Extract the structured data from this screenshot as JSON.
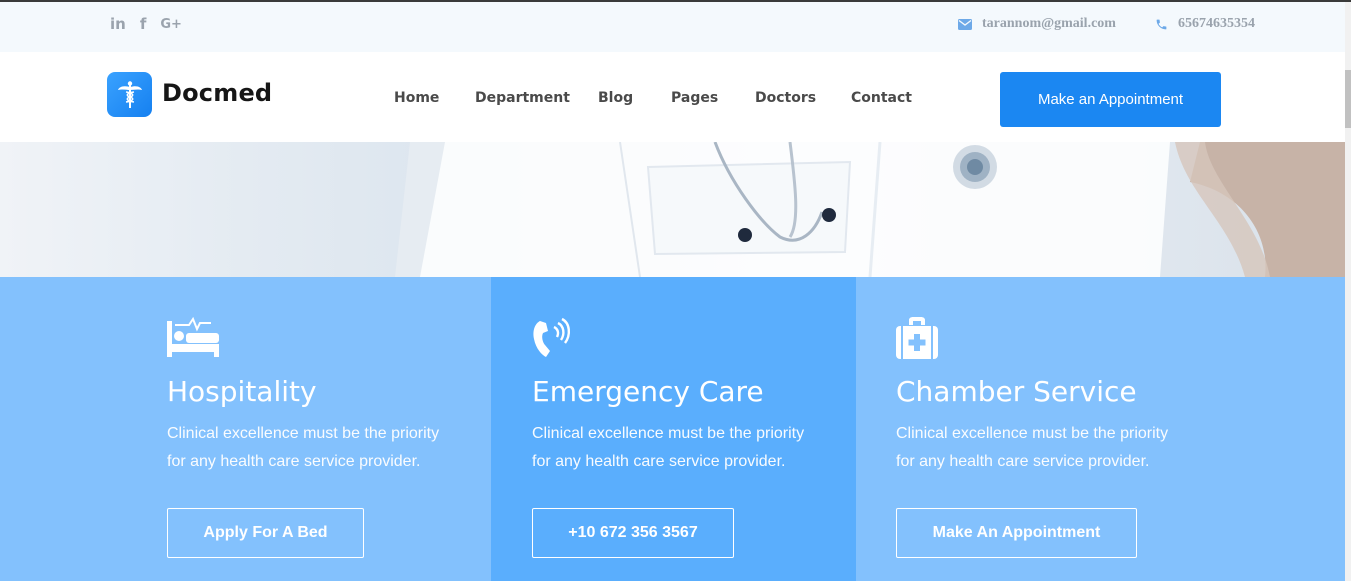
{
  "topbar": {
    "social": [
      {
        "label": "in",
        "icon": "linkedin-icon"
      },
      {
        "label": "f",
        "icon": "facebook-icon"
      },
      {
        "label": "G+",
        "icon": "google-plus-icon"
      }
    ],
    "email": "tarannom@gmail.com",
    "phone": "65674635354"
  },
  "header": {
    "logo_text": "Docmed",
    "logo_icon": "caduceus-icon",
    "nav": [
      "Home",
      "Department",
      "Blog",
      "Pages",
      "Doctors",
      "Contact"
    ],
    "cta_label": "Make an Appointment"
  },
  "colors": {
    "accent": "#1b87f2",
    "card_light": "#83c1fd",
    "card_dark": "#5aaefd"
  },
  "services": [
    {
      "icon": "hospital-bed-icon",
      "title": "Hospitality",
      "description": "Clinical excellence must be the priority for any health care service provider.",
      "button": "Apply For A Bed"
    },
    {
      "icon": "phone-call-icon",
      "title": "Emergency Care",
      "description": "Clinical excellence must be the priority for any health care service provider.",
      "button": "+10 672 356 3567"
    },
    {
      "icon": "first-aid-kit-icon",
      "title": "Chamber Service",
      "description": "Clinical excellence must be the priority for any health care service provider.",
      "button": "Make An Appointment"
    }
  ]
}
